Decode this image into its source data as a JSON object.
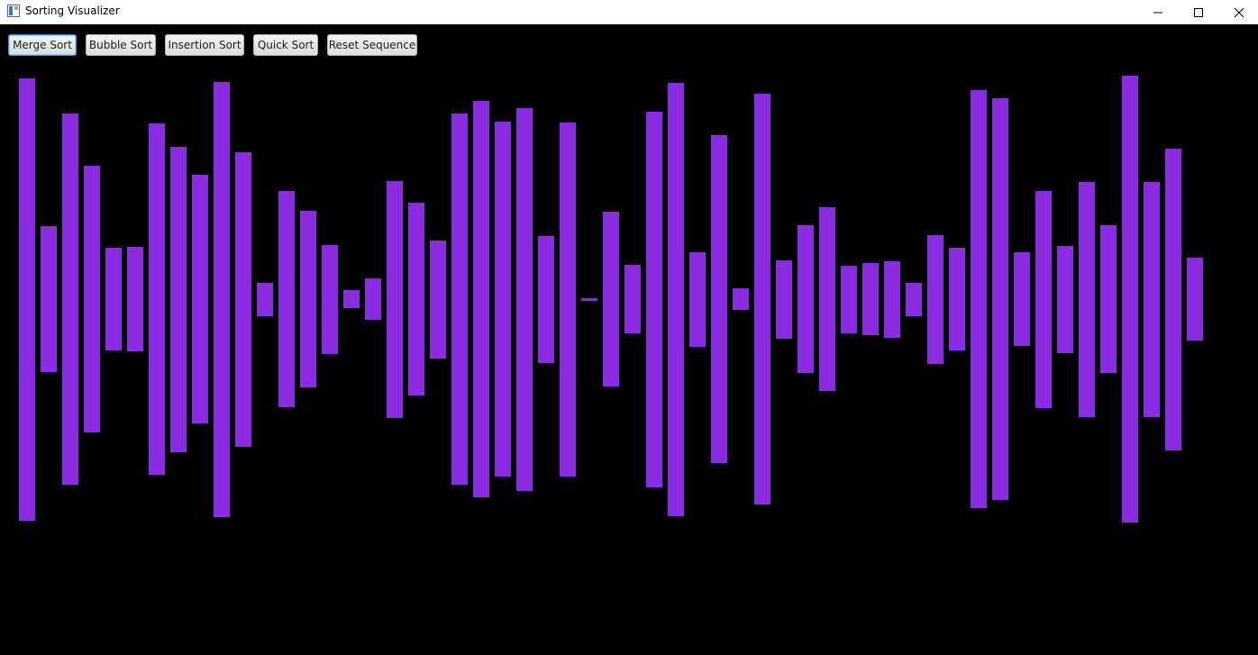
{
  "window": {
    "title": "Sorting Visualizer",
    "controls": {
      "minimize": "minimize-icon",
      "maximize": "maximize-icon",
      "close": "close-icon"
    }
  },
  "toolbar": {
    "buttons": [
      {
        "label": "Merge Sort",
        "focused": true
      },
      {
        "label": "Bubble Sort"
      },
      {
        "label": "Insertion Sort"
      },
      {
        "label": "Quick Sort"
      },
      {
        "label": "Reset Sequence"
      }
    ]
  },
  "colors": {
    "bar": "#8a2be2",
    "background": "#000000",
    "focus": "#3d8fe0"
  },
  "bars": {
    "center_value": 332,
    "values": [
      491,
      162,
      412,
      296,
      114,
      116,
      390,
      339,
      276,
      483,
      327,
      37,
      240,
      196,
      121,
      20,
      46,
      263,
      214,
      131,
      412,
      440,
      394,
      425,
      141,
      393,
      3,
      194,
      76,
      417,
      481,
      105,
      364,
      24,
      456,
      87,
      164,
      204,
      75,
      80,
      85,
      37,
      143,
      114,
      464,
      446,
      104,
      241,
      119,
      261,
      164,
      496,
      261,
      335,
      92
    ]
  }
}
